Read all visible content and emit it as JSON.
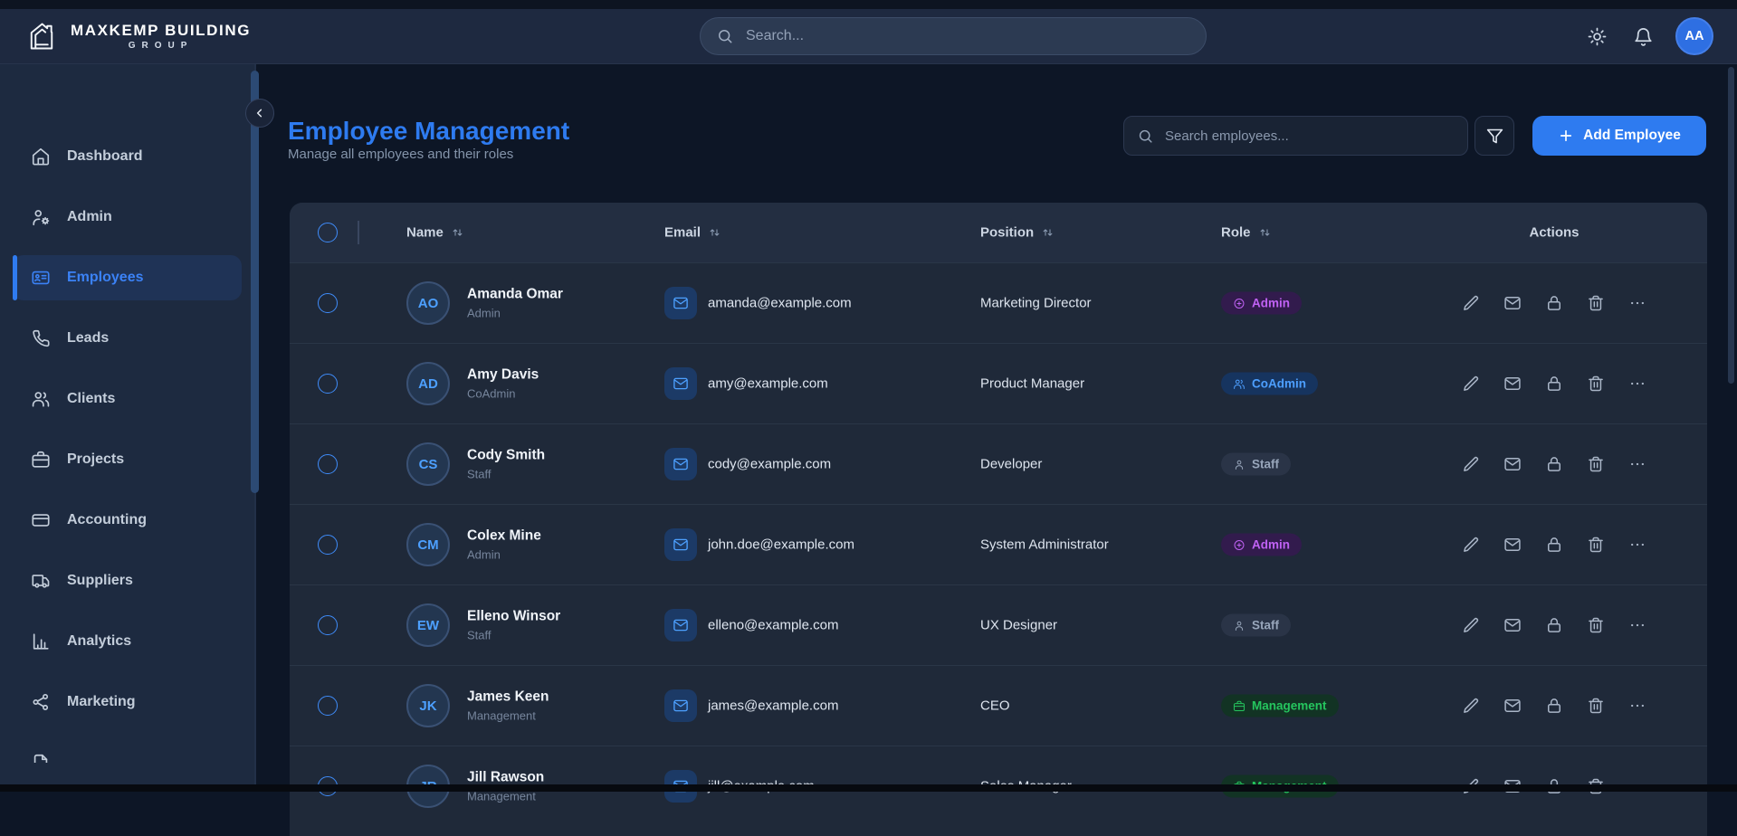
{
  "topbar": {
    "brand_line1": "MAXKEMP BUILDING",
    "brand_line2": "GROUP",
    "search_placeholder": "Search...",
    "avatar_initials": "AA"
  },
  "page": {
    "title": "Employee Management",
    "subtitle": "Manage all employees and their roles",
    "search_placeholder": "Search employees...",
    "add_button_label": "Add Employee"
  },
  "sidebar": {
    "items": [
      {
        "label": "Dashboard",
        "icon": "home",
        "active": false
      },
      {
        "label": "Admin",
        "icon": "user-cog",
        "active": false
      },
      {
        "label": "Employees",
        "icon": "id-card",
        "active": true
      },
      {
        "label": "Leads",
        "icon": "phone",
        "active": false
      },
      {
        "label": "Clients",
        "icon": "users",
        "active": false
      },
      {
        "label": "Projects",
        "icon": "briefcase",
        "active": false
      },
      {
        "label": "Accounting",
        "icon": "credit-card",
        "active": false
      },
      {
        "label": "Suppliers",
        "icon": "truck",
        "active": false
      },
      {
        "label": "Analytics",
        "icon": "bar-chart",
        "active": false
      },
      {
        "label": "Marketing",
        "icon": "share",
        "active": false
      },
      {
        "label": "",
        "icon": "file-text",
        "active": false
      }
    ]
  },
  "table": {
    "headers": {
      "name": "Name",
      "email": "Email",
      "position": "Position",
      "role": "Role",
      "actions": "Actions"
    },
    "employees": [
      {
        "name": "Amanda Omar",
        "subtitle": "Admin",
        "initials": "AO",
        "email": "amanda@example.com",
        "position": "Marketing Director",
        "role": "Admin"
      },
      {
        "name": "Amy Davis",
        "subtitle": "CoAdmin",
        "initials": "AD",
        "email": "amy@example.com",
        "position": "Product Manager",
        "role": "CoAdmin"
      },
      {
        "name": "Cody Smith",
        "subtitle": "Staff",
        "initials": "CS",
        "email": "cody@example.com",
        "position": "Developer",
        "role": "Staff"
      },
      {
        "name": "Colex Mine",
        "subtitle": "Admin",
        "initials": "CM",
        "email": "john.doe@example.com",
        "position": "System Administrator",
        "role": "Admin"
      },
      {
        "name": "Elleno Winsor",
        "subtitle": "Staff",
        "initials": "EW",
        "email": "elleno@example.com",
        "position": "UX Designer",
        "role": "Staff"
      },
      {
        "name": "James Keen",
        "subtitle": "Management",
        "initials": "JK",
        "email": "james@example.com",
        "position": "CEO",
        "role": "Management"
      },
      {
        "name": "Jill Rawson",
        "subtitle": "Management",
        "initials": "JR",
        "email": "jill@example.com",
        "position": "Sales Manager",
        "role": "Management"
      }
    ]
  },
  "roles": {
    "Admin": {
      "bg": "#321b4d",
      "color": "#c062f4",
      "icon": "circle-plus"
    },
    "CoAdmin": {
      "bg": "#16345f",
      "color": "#4d9fff",
      "icon": "users"
    },
    "Staff": {
      "bg": "#2a3447",
      "color": "#98a6bb",
      "icon": "user"
    },
    "Management": {
      "bg": "#123324",
      "color": "#25c55e",
      "icon": "briefcase"
    }
  },
  "colors": {
    "accent": "#2e7bf0",
    "topbar_bg": "#1e2940",
    "sidebar_bg": "#1d2a40",
    "main_bg": "#0d1626",
    "card_bg": "#1f2939",
    "header_bg": "#232e41",
    "avatar_bg": "#2e6fe2"
  }
}
